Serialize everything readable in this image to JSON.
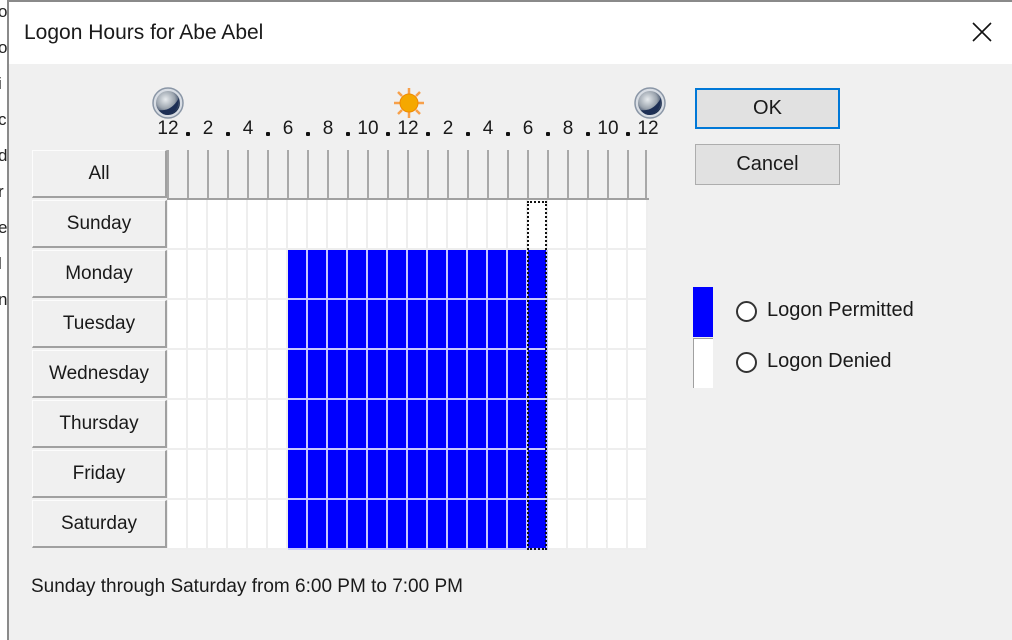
{
  "background_fragment_letters": [
    "o",
    "o",
    "i",
    "c",
    "d",
    "r",
    "e",
    "l",
    "n"
  ],
  "dialog": {
    "title": "Logon Hours for Abe Abel",
    "close_icon": "close-icon"
  },
  "timeline": {
    "hour_labels": [
      "12",
      "2",
      "4",
      "6",
      "8",
      "10",
      "12",
      "2",
      "4",
      "6",
      "8",
      "10",
      "12"
    ],
    "icons": [
      "moon-icon",
      "sun-icon",
      "moon-icon"
    ]
  },
  "grid": {
    "all_label": "All",
    "days": [
      "Sunday",
      "Monday",
      "Tuesday",
      "Wednesday",
      "Thursday",
      "Friday",
      "Saturday"
    ],
    "hours_per_day": 24,
    "permitted_hours": {
      "Sunday": [],
      "Monday": [
        6,
        7,
        8,
        9,
        10,
        11,
        12,
        13,
        14,
        15,
        16,
        17,
        18
      ],
      "Tuesday": [
        6,
        7,
        8,
        9,
        10,
        11,
        12,
        13,
        14,
        15,
        16,
        17,
        18
      ],
      "Wednesday": [
        6,
        7,
        8,
        9,
        10,
        11,
        12,
        13,
        14,
        15,
        16,
        17,
        18
      ],
      "Thursday": [
        6,
        7,
        8,
        9,
        10,
        11,
        12,
        13,
        14,
        15,
        16,
        17,
        18
      ],
      "Friday": [
        6,
        7,
        8,
        9,
        10,
        11,
        12,
        13,
        14,
        15,
        16,
        17,
        18
      ],
      "Saturday": [
        6,
        7,
        8,
        9,
        10,
        11,
        12,
        13,
        14,
        15,
        16,
        17,
        18
      ]
    },
    "selection": {
      "hour": 18,
      "from_day": "Sunday",
      "to_day": "Saturday"
    },
    "permitted_color": "#0000ff",
    "denied_color": "#ffffff"
  },
  "buttons": {
    "ok": "OK",
    "cancel": "Cancel"
  },
  "legend": {
    "permitted": "Logon Permitted",
    "denied": "Logon Denied",
    "permitted_selected": false,
    "denied_selected": false
  },
  "status_text": "Sunday through Saturday from 6:00 PM to 7:00 PM"
}
